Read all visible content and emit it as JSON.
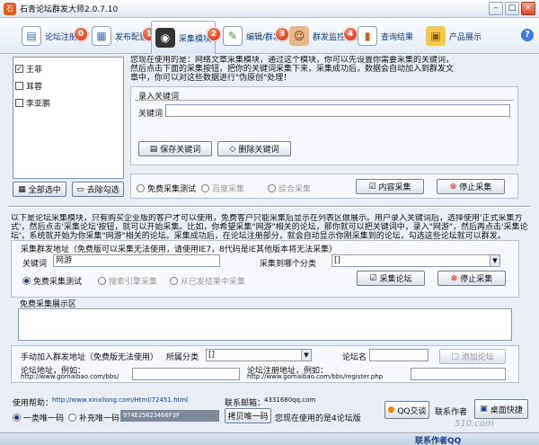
{
  "window": {
    "title": "石青论坛群发大师2.0.7.10",
    "minimize": "–",
    "maximize": "□",
    "close": "×"
  },
  "toolbar": {
    "items": [
      {
        "label": "论坛注册",
        "icon": "register-icon"
      },
      {
        "label": "发布配置",
        "icon": "config-icon"
      },
      {
        "label": "采集模块",
        "icon": "binoculars-icon"
      },
      {
        "label": "编辑/群发",
        "icon": "edit-icon"
      },
      {
        "label": "群发监控",
        "icon": "monitor-icon"
      },
      {
        "label": "查询结果",
        "icon": "chart-icon"
      },
      {
        "label": "产品展示",
        "icon": "product-icon"
      }
    ],
    "steps": [
      "0",
      "1",
      "2",
      "3",
      "4"
    ],
    "help": "?"
  },
  "keyword_list": {
    "items": [
      {
        "label": "王菲",
        "checked": true
      },
      {
        "label": "耳蓉",
        "checked": false
      },
      {
        "label": "李亚鹏",
        "checked": false
      }
    ],
    "select_all": "全部选中",
    "deselect": "去除勾选"
  },
  "top": {
    "description": "您现在使用的是：网络文章采集模块，通过这个模块，你可以先设置你需要采集的关键词，然后点击下面的采集按钮，把你的关键词采集下来，采集成功后，数据会自动加入到群发文章中，你可以对这些数据进行\"伪原创\"处理！",
    "keyword_section": "录入关键词",
    "keyword_label": "关键词",
    "keyword_value": "",
    "save_keyword": "保存关键词",
    "delete_keyword": "删除关键词",
    "radios": [
      {
        "label": "免费采集测试",
        "enabled": true
      },
      {
        "label": "百度采集",
        "enabled": false
      },
      {
        "label": "综合采集",
        "enabled": false
      }
    ],
    "content_collect": "内容采集",
    "stop_collect": "停止采集"
  },
  "forum": {
    "description": "以下是论坛采集模块，只有购买企业版的客户才可以使用，免费客户只能采集后显示在列表区做展示。用户录入关键词后，选择使用'正式采集方式'，然后点击'采集论坛'按钮，就可以开始采集。比如，你希望采集\"网游\"相关的论坛，那你就可以把关键词中，录入\"网游\"，然后再点击'采集论坛'，系统就开始为你采集\"网游\"相关的论坛。采集成功后，在论坛注册部分，就会自动显示你刚采集到的论坛，勾选这些论坛就可以群发。",
    "section_title": "采集群发地址（免费版可以采集无法使用，请使用IE7，8代码是IE其他版本将无法采集）",
    "keyword_label": "关键词",
    "keyword_value": "网游",
    "category_label": "采集到哪个分类",
    "category_value": "[]",
    "radios": [
      {
        "label": "免费采集测试",
        "selected": true,
        "enabled": true
      },
      {
        "label": "搜索引擎采集",
        "selected": false,
        "enabled": false
      },
      {
        "label": "从已发结果中采集",
        "selected": false,
        "enabled": false
      }
    ],
    "collect_forum": "采集论坛",
    "stop_collect": "停止采集",
    "display_area_label": "免费采集展示区"
  },
  "manual": {
    "title": "手动加入群发地址（免费版无法使用）",
    "category_label": "所属分类",
    "category_value": "[]",
    "forum_name_label": "论坛名",
    "add_forum": "添加论坛",
    "forum_address_label": "论坛地址，例如：",
    "forum_address_example": "http://www.gomaibao.com/bbs/",
    "register_address_label": "论坛注册地址，例如：",
    "register_address_example": "http://www.gomaibao.com/bbs/register.php"
  },
  "footer": {
    "help_label": "使用帮助：",
    "help_url": "http://www.xinxilong.com/Html/72451.html",
    "qq_label": "联系邮箱：",
    "qq_value": "4331680qq.com",
    "radio_one": "一类唯一码",
    "radio_two": "补充唯一码",
    "machine_code": "974E25023466F3F",
    "copy_code": "拷贝唯一码",
    "usage_info": "您现在使用的是4论坛版",
    "qq_button": "QQ交谈",
    "contact_author": "联系作者",
    "desktop_shortcut": "桌面快捷",
    "status_text": "联系作者QQ",
    "watermark": "510.com"
  }
}
